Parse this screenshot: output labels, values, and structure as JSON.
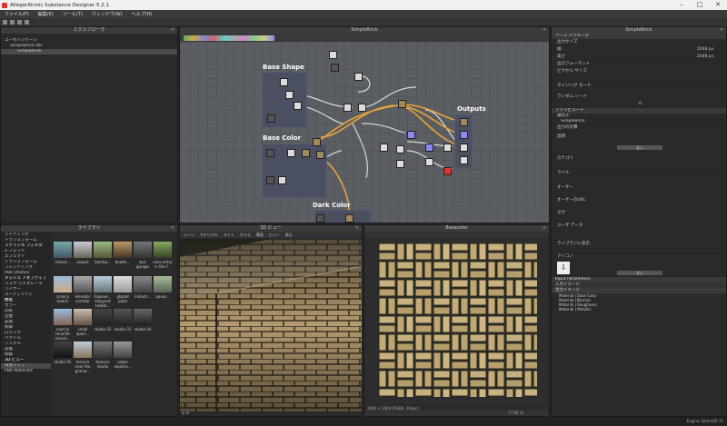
{
  "window": {
    "title": "Allegorithmic Substance Designer 5.2.1"
  },
  "menu": [
    "ファイル(F)",
    "編集(E)",
    "ツール(T)",
    "ウィンドウ(W)",
    "ヘルプ(H)"
  ],
  "explorer": {
    "title": "エクスプローラ",
    "items": [
      "ユーザパッケージ",
      "SimpleBrick.sbs",
      "SimpleBrick"
    ]
  },
  "graph": {
    "title": "SimpleBrick",
    "frames": [
      "Base Shape",
      "Base Color",
      "Dark Color",
      "Outputs"
    ]
  },
  "library": {
    "title": "ライブラリ",
    "categories": [
      "ライティング",
      "トランスフォーム",
      "マテリアル フィルタ",
      "1-ブレンド",
      "エフェクト",
      "トランスフォーム",
      "ブレンディング",
      "PBR Utilities",
      "メッシュ アダプティブ",
      "マスク ジェネレータ",
      "ワイヤー",
      "ユーティリティ",
      "機能",
      "カラー",
      "比較",
      "定数",
      "変換",
      "制御",
      "ロジック",
      "ベクトル",
      "ワングル",
      "変換",
      "制御"
    ],
    "sec3d": "3D ビュー",
    "env": "環境マップ",
    "pbr": "PBR Materials",
    "thumbs": [
      [
        "Island...",
        "airport",
        "bambo...",
        "bowlin...",
        "bus garage",
        "cave entry in the f..."
      ],
      [
        "corsica beach",
        "elevator corridor",
        "Glasswi... shipyard (webb...",
        "glazed patio",
        "industr...",
        "panor..."
      ],
      [
        "road to tenerife mount...",
        "small apart...",
        "studio 02",
        "studio 03",
        "studio 04",
        ""
      ],
      [
        "studio 05",
        "terrace near the granar...",
        "tomoco studio",
        "urban explora...",
        "",
        ""
      ]
    ]
  },
  "view3d": {
    "title": "3D ビュー",
    "menu": [
      "シーン",
      "マテリアル",
      "ライト",
      "カメラ",
      "環境",
      "ビュー",
      "表示"
    ]
  },
  "view2d": {
    "title": "Basecolor",
    "status": "2048 × 2048 (RGBA, 16bpc)",
    "zoom": "17.81 %"
  },
  "properties": {
    "title": "SimpleBrick",
    "base_params": "ベース パラメータ",
    "output_size": "出力サイズ",
    "width_label": "幅",
    "height_label": "高さ",
    "width_value": "2048 px",
    "height_value": "2048 px",
    "output_format": "出力フォーマット",
    "pixel_size": "ピクセル サイズ",
    "tiling": "タイリング モード",
    "random_seed": "ランダム シード",
    "seed_value": "0",
    "attributes": "アトリビュート",
    "identifier_label": "識別子",
    "identifier_value": "SimpleBrick",
    "output_size_label": "出力の計算",
    "button_none": "なし",
    "description": "説明",
    "category": "カテゴリ",
    "label": "ラベル",
    "author": "オーサー",
    "author_url": "オーサーのURL",
    "tags": "タグ",
    "user_data": "ユーザ データ",
    "thumbnail": "ライブラリに表示",
    "icon": "アイコン",
    "input_params": "Input Parameters",
    "inputs": "入力イメージ",
    "outputs": "出力イメージ",
    "output_list": [
      "Material | Base Color",
      "Material | Normal",
      "Material | Roughness",
      "Material | Metallic"
    ],
    "engine": "Engine: Direct3D 11"
  },
  "colors": {
    "accent": "#e8a33c",
    "frame": "#4a4f62",
    "blue_node": "#8a8af0"
  }
}
